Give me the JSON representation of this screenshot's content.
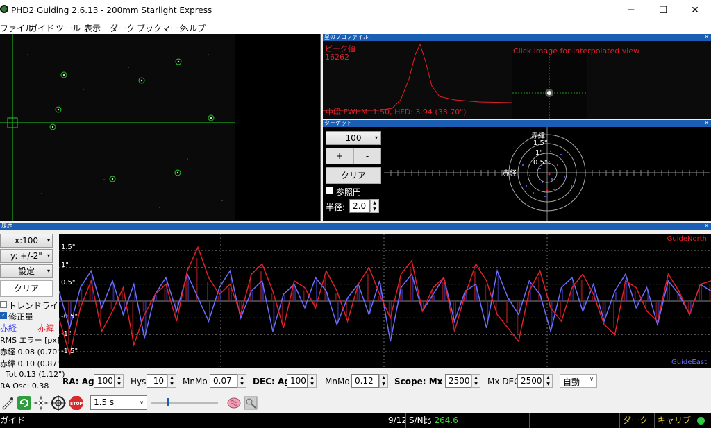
{
  "window": {
    "title": "PHD2 Guiding 2.6.13 - 200mm Starlight Express"
  },
  "menu": [
    "ファイル",
    "ガイド",
    "ツール",
    "表示",
    "ダーク",
    "ブックマーク",
    "ヘルプ"
  ],
  "profile": {
    "title": "星のプロファイル",
    "peak_label": "ピーク値",
    "peak_value": "16262",
    "click_hint": "Click image for interpolated view",
    "fwhm_text": "中段 FWHM: 1.50, HFD: 3.94 (33.70\")"
  },
  "target": {
    "title": "ターゲット",
    "zoom_value": "100",
    "plus_label": "+",
    "minus_label": "-",
    "clear_label": "クリア",
    "ref_circle_label": "参照円",
    "radius_label": "半径:",
    "radius_value": "2.0",
    "ring_labels": [
      "赤緯",
      "1.5\"",
      "1\"",
      "0.5\""
    ],
    "axis_label": "赤経"
  },
  "history": {
    "title": "履歴",
    "x_scale": "x:100",
    "y_scale": "y: +/-2\"",
    "settings_label": "設定",
    "clear_label": "クリア",
    "trendline_label": "トレンドライン",
    "correction_label": "修正量",
    "ra_legend": "赤経",
    "dec_legend": "赤緯",
    "rms_title": "RMS エラー [px] :",
    "rms_ra": "赤経 0.08 (0.70\")",
    "rms_dec": "赤緯 0.10 (0.87\")",
    "rms_tot": "Tot 0.13 (1.12\")",
    "ra_osc": "RA Osc: 0.38",
    "guide_north": "GuideNorth",
    "guide_east": "GuideEast",
    "y_ticks": [
      "1.5\"",
      "1\"",
      "0.5\"",
      "-0.5\"",
      "-1\"",
      "-1.5\""
    ]
  },
  "params": {
    "ra_label": "RA: Agr",
    "ra_agr": "100",
    "hys_label": "Hys",
    "hys": "10",
    "mnmo_label": "MnMo",
    "ra_mnmo": "0.07",
    "dec_label": "DEC: Agr",
    "dec_agr": "100",
    "dec_mnmo_label": "MnMo",
    "dec_mnmo": "0.12",
    "scope_label": "Scope: Mx RA",
    "mx_ra": "2500",
    "mx_dec_label": "Mx DEC",
    "mx_dec": "2500",
    "mode": "自動"
  },
  "toolbar": {
    "exposure": "1.5 s"
  },
  "status": {
    "left": "ガイド",
    "frame": "9/12",
    "snr_label": "S/N比",
    "snr_value": "264.6",
    "dark": "ダーク",
    "calib": "キャリブ"
  },
  "colors": {
    "ra": "#6c6cff",
    "dec": "#e0202a",
    "accent": "#1a5fb4",
    "crosshair": "#22cc22"
  },
  "chart_data": {
    "type": "line",
    "ylim": [
      -2,
      2
    ],
    "series": [
      {
        "name": "赤経",
        "values": [
          0.3,
          -0.8,
          0.4,
          0.9,
          -0.2,
          0.6,
          -0.4,
          0.5,
          -1.1,
          0.2,
          0.7,
          -0.3,
          0.8,
          0.1,
          -0.6,
          0.4,
          0.9,
          -0.5,
          0.3,
          0.6,
          -0.9,
          0.2,
          0.5,
          -0.2,
          0.7,
          0.3,
          -0.7,
          0.1,
          0.5,
          -0.4,
          0.6,
          -1.2,
          0.4,
          0.8,
          -0.3,
          0.2,
          0.7,
          -0.6,
          0.3,
          0.5,
          -0.8,
          0.9,
          0.1,
          -0.4,
          0.6,
          0.2,
          -0.9,
          0.4,
          0.7,
          -0.3,
          0.5,
          -0.6,
          0.3,
          0.8,
          -0.2,
          0.4,
          -0.7,
          0.6,
          0.2,
          -0.4,
          0.5,
          0.3
        ]
      },
      {
        "name": "赤緯",
        "values": [
          -0.5,
          -1.6,
          -0.2,
          0.6,
          -0.9,
          -0.3,
          0.4,
          -1.3,
          -0.4,
          0.2,
          0.5,
          -0.6,
          0.9,
          1.6,
          0.7,
          0.2,
          0.5,
          -0.4,
          0.8,
          1.1,
          0.3,
          -0.8,
          0.6,
          0.4,
          -0.2,
          0.9,
          0.3,
          -0.6,
          0.5,
          1.0,
          0.2,
          -0.5,
          0.8,
          1.2,
          -0.3,
          0.4,
          0.7,
          -0.9,
          0.2,
          1.1,
          0.6,
          -0.4,
          -0.8,
          -1.2,
          0.3,
          0.9,
          -0.2,
          -0.6,
          0.4,
          0.8,
          0.2,
          -0.7,
          -1.0,
          0.6,
          0.4,
          -0.3,
          -0.6,
          0.8,
          0.3,
          -0.4,
          0.5,
          0.6
        ]
      }
    ]
  }
}
